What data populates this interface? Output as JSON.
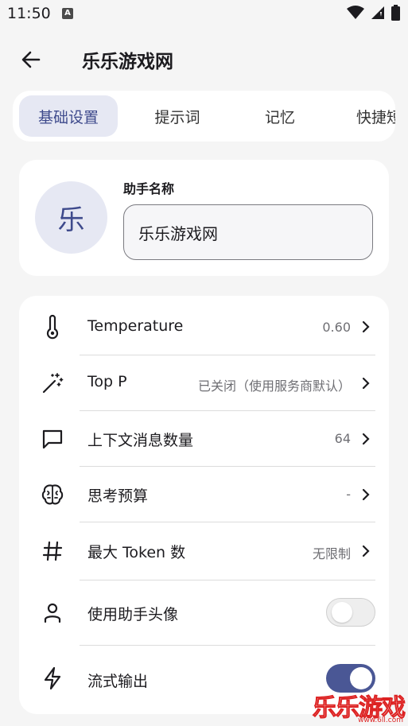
{
  "status": {
    "time": "11:50",
    "notification_letter": "A"
  },
  "header": {
    "title": "乐乐游戏网"
  },
  "tabs": [
    {
      "label": "基础设置",
      "active": true
    },
    {
      "label": "提示词",
      "active": false
    },
    {
      "label": "记忆",
      "active": false
    },
    {
      "label": "快捷短语",
      "active": false
    }
  ],
  "assistant": {
    "avatar_text": "乐",
    "name_label": "助手名称",
    "name_value": "乐乐游戏网"
  },
  "settings": {
    "temperature": {
      "label": "Temperature",
      "value": "0.60"
    },
    "top_p": {
      "label": "Top P",
      "value": "已关闭（使用服务商默认）"
    },
    "context_count": {
      "label": "上下文消息数量",
      "value": "64"
    },
    "thinking_budget": {
      "label": "思考预算",
      "value": "-"
    },
    "max_tokens": {
      "label": "最大 Token 数",
      "value": "无限制"
    },
    "use_avatar": {
      "label": "使用助手头像",
      "enabled": false
    },
    "streaming": {
      "label": "流式输出",
      "enabled": true
    }
  },
  "colors": {
    "accent": "#4a5795",
    "accent_bg": "#e6e8f3",
    "background": "#f5f5f5"
  },
  "watermark": {
    "text": "乐乐游戏",
    "url": "www.6ll.com"
  }
}
